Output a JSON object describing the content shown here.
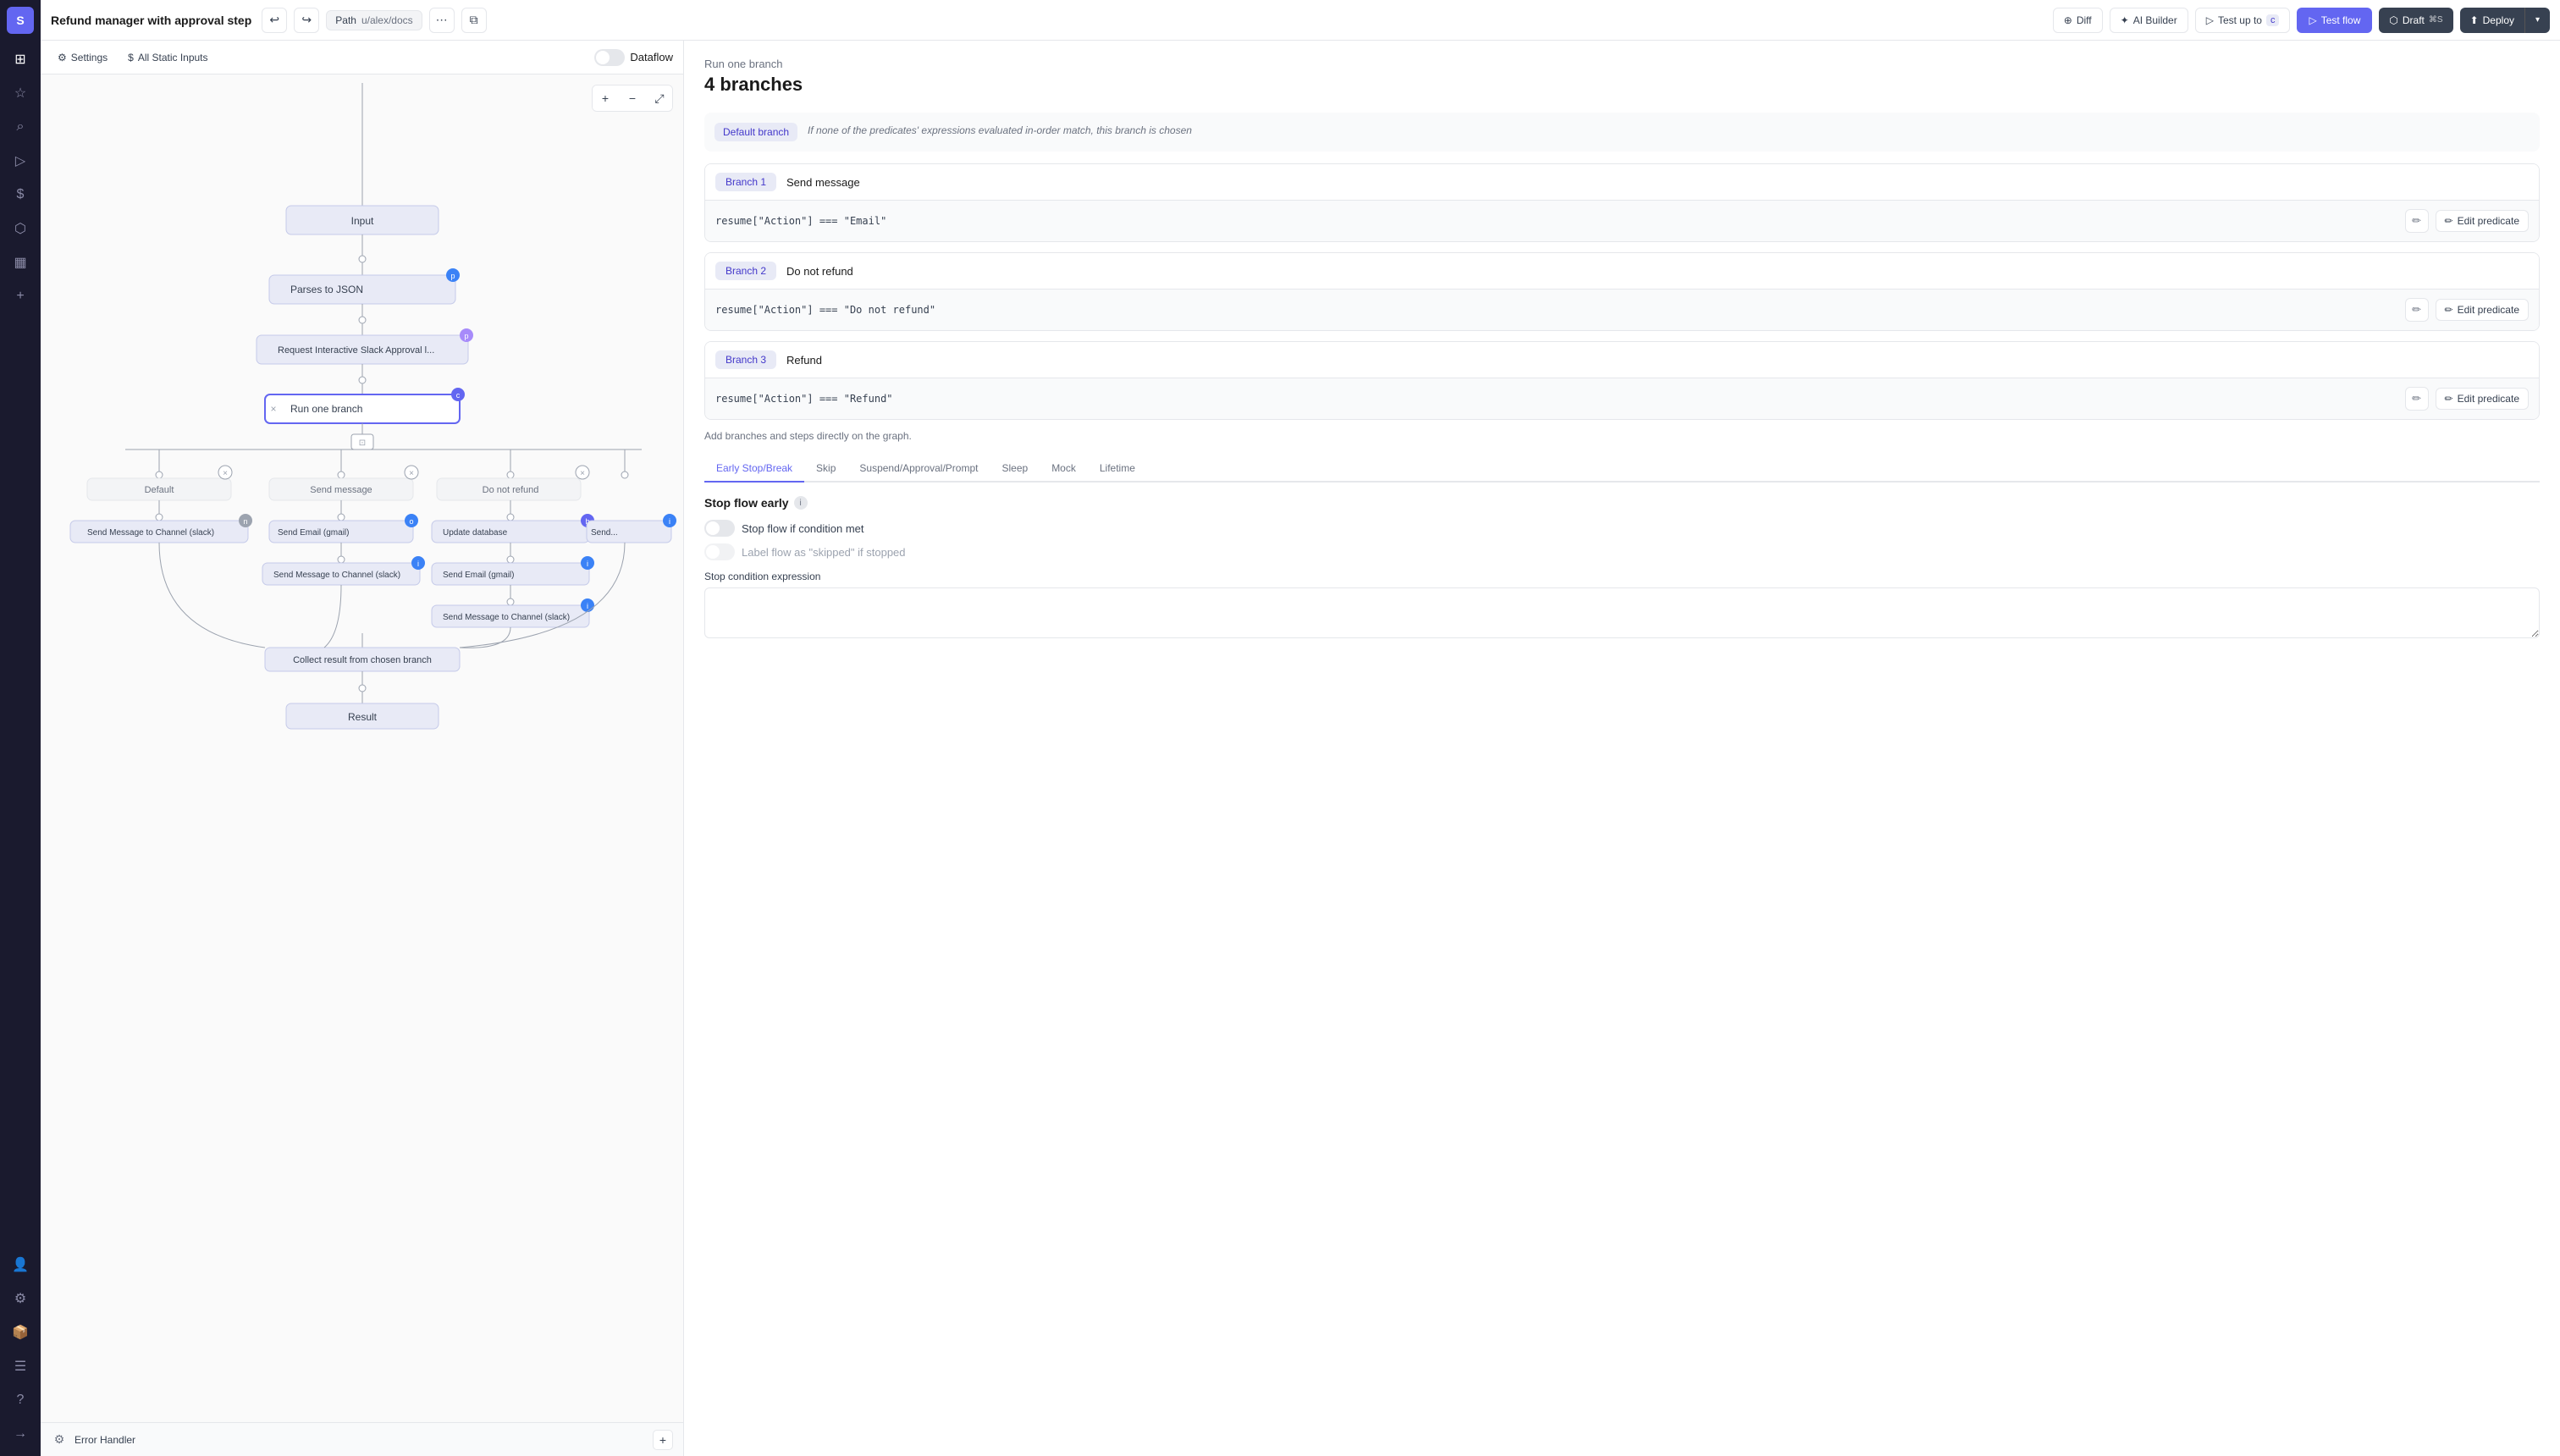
{
  "app": {
    "logo": "S",
    "title": "Refund manager with approval step",
    "path_label": "Path",
    "path_value": "u/alex/docs"
  },
  "topbar": {
    "undo_label": "↩",
    "redo_label": "↪",
    "diff_label": "Diff",
    "ai_builder_label": "AI Builder",
    "test_up_to_label": "Test up to",
    "test_up_to_key": "c",
    "test_flow_label": "Test flow",
    "draft_label": "Draft",
    "draft_key": "⌘S",
    "deploy_label": "Deploy"
  },
  "sub_toolbar": {
    "settings_label": "Settings",
    "all_static_inputs_label": "All Static Inputs",
    "dataflow_label": "Dataflow"
  },
  "right_panel": {
    "section_label": "Run one branch",
    "section_count": "4 branches",
    "default_branch": {
      "badge": "Default branch",
      "description": "If none of the predicates' expressions evaluated in-order match, this branch is chosen"
    },
    "branches": [
      {
        "badge": "Branch 1",
        "name": "Send message",
        "predicate": "resume[\"Action\"] === \"Email\"",
        "edit_label": "Edit predicate"
      },
      {
        "badge": "Branch 2",
        "name": "Do not refund",
        "predicate": "resume[\"Action\"] === \"Do not refund\"",
        "edit_label": "Edit predicate"
      },
      {
        "badge": "Branch 3",
        "name": "Refund",
        "predicate": "resume[\"Action\"] === \"Refund\"",
        "edit_label": "Edit predicate"
      }
    ],
    "add_note": "Add branches and steps directly on the graph.",
    "tabs": [
      {
        "label": "Early Stop/Break",
        "active": true
      },
      {
        "label": "Skip",
        "active": false
      },
      {
        "label": "Suspend/Approval/Prompt",
        "active": false
      },
      {
        "label": "Sleep",
        "active": false
      },
      {
        "label": "Mock",
        "active": false
      },
      {
        "label": "Lifetime",
        "active": false
      }
    ],
    "stop_flow_title": "Stop flow early",
    "stop_flow_toggle_label": "Stop flow if condition met",
    "label_flow_label": "Label flow as \"skipped\" if stopped",
    "stop_condition_label": "Stop condition expression"
  },
  "flow_nodes": {
    "input_label": "Input",
    "parses_label": "Parses to JSON",
    "slack_label": "Request Interactive Slack Approval l...",
    "branch_label": "Run one branch",
    "collect_label": "Collect result from chosen branch",
    "result_label": "Result",
    "error_label": "Error Handler",
    "branches": [
      {
        "label": "Default",
        "steps": [
          "Send Message to Channel (slack)"
        ]
      },
      {
        "label": "Send message",
        "steps": [
          "Send Email (gmail)",
          "Send Message to Channel (slack)"
        ]
      },
      {
        "label": "Do not refund",
        "steps": [
          "Update database",
          "Send Email (gmail)",
          "Send Message to Channel (slack)"
        ]
      },
      {
        "label": "...",
        "steps": [
          "Send..."
        ]
      }
    ]
  },
  "sidebar_icons": [
    {
      "name": "home-icon",
      "symbol": "⊞",
      "interactable": true
    },
    {
      "name": "star-icon",
      "symbol": "☆",
      "interactable": true
    },
    {
      "name": "search-icon",
      "symbol": "⌕",
      "interactable": true
    },
    {
      "name": "flow-icon",
      "symbol": "⟶",
      "interactable": true
    },
    {
      "name": "dollar-icon",
      "symbol": "$",
      "interactable": true
    },
    {
      "name": "puzzle-icon",
      "symbol": "⧖",
      "interactable": true
    },
    {
      "name": "calendar-icon",
      "symbol": "▦",
      "interactable": true
    },
    {
      "name": "add-icon",
      "symbol": "+",
      "interactable": true
    },
    {
      "name": "person-icon",
      "symbol": "👤",
      "interactable": true
    },
    {
      "name": "gear-icon",
      "symbol": "⚙",
      "interactable": true
    },
    {
      "name": "box-icon",
      "symbol": "⬡",
      "interactable": true
    },
    {
      "name": "list-icon",
      "symbol": "☰",
      "interactable": true
    },
    {
      "name": "help-icon",
      "symbol": "?",
      "interactable": true
    },
    {
      "name": "expand-icon",
      "symbol": "→",
      "interactable": true
    }
  ]
}
